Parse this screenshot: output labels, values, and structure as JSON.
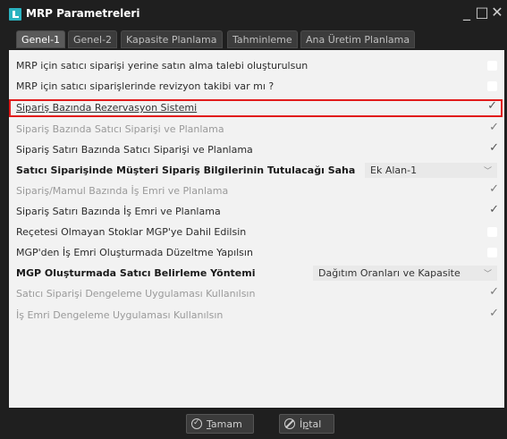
{
  "window": {
    "title": "MRP Parametreleri",
    "minimize": "_",
    "maximize": "□",
    "close": "✕"
  },
  "tabs": [
    {
      "label": "Genel-1"
    },
    {
      "label": "Genel-2"
    },
    {
      "label": "Kapasite Planlama"
    },
    {
      "label": "Tahminleme"
    },
    {
      "label": "Ana Üretim Planlama"
    }
  ],
  "rows": [
    {
      "label": "MRP için satıcı siparişi yerine satın alma talebi oluşturulsun",
      "checked": false
    },
    {
      "label": "MRP için satıcı siparişlerinde revizyon takibi var mı ?",
      "checked": false
    },
    {
      "label": "Sipariş Bazında Rezervasyon Sistemi",
      "checked": true
    },
    {
      "label": "Sipariş Bazında Satıcı Siparişi ve Planlama",
      "checked": true
    },
    {
      "label": "Sipariş Satırı Bazında Satıcı Siparişi ve Planlama",
      "checked": true
    },
    {
      "label": "Satıcı Siparişinde Müşteri Sipariş Bilgilerinin Tutulacağı Saha",
      "value": "Ek Alan-1"
    },
    {
      "label": "Sipariş/Mamul Bazında İş Emri ve Planlama",
      "checked": true
    },
    {
      "label": "Sipariş Satırı Bazında İş Emri ve Planlama",
      "checked": true
    },
    {
      "label": "Reçetesi Olmayan Stoklar MGP'ye Dahil Edilsin",
      "checked": false
    },
    {
      "label": "MGP'den İş Emri Oluşturmada Düzeltme Yapılsın",
      "checked": false
    },
    {
      "label": "MGP Oluşturmada Satıcı Belirleme Yöntemi",
      "value": "Dağıtım Oranları ve Kapasite"
    },
    {
      "label": "Satıcı Siparişi Dengeleme Uygulaması Kullanılsın",
      "checked": true
    },
    {
      "label": "İş Emri Dengeleme Uygulaması Kullanılsın",
      "checked": true
    }
  ],
  "footer": {
    "ok_underlined": "T",
    "ok_rest": "amam",
    "cancel_prefix": "İ",
    "cancel_underlined": "p",
    "cancel_rest": "tal"
  },
  "colors": {
    "highlight_border": "#e11b1b",
    "titlebar": "#1f1f1f",
    "panel": "#f2f2f2"
  }
}
